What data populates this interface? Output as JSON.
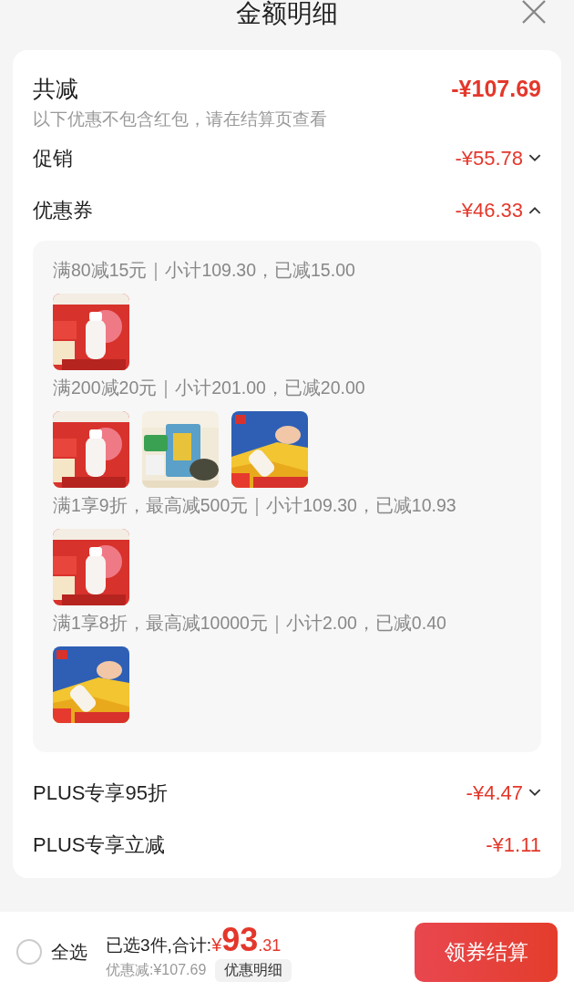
{
  "header": {
    "title": "金额明细"
  },
  "summary": {
    "label": "共减",
    "amount": "-¥107.69",
    "note": "以下优惠不包含红包，请在结算页查看"
  },
  "rows": [
    {
      "label": "促销",
      "amount": "-¥55.78",
      "expanded": false
    },
    {
      "label": "优惠券",
      "amount": "-¥46.33",
      "expanded": true,
      "groups": [
        {
          "title": "满80减15元｜小计109.30，已减15.00"
        },
        {
          "title": "满200减20元｜小计201.00，已减20.00"
        },
        {
          "title": "满1享9折，最高减500元｜小计109.30，已减10.93"
        },
        {
          "title": "满1享8折，最高减10000元｜小计2.00，已减0.40"
        }
      ]
    },
    {
      "label": "PLUS专享95折",
      "amount": "-¥4.47",
      "expanded": false
    },
    {
      "label": "PLUS专享立减",
      "amount": "-¥1.11"
    }
  ],
  "footer": {
    "select_all": {
      "label": "全选",
      "checked": false
    },
    "selected_text": "已选3件,合计:",
    "currency": "¥",
    "total_integer": "93",
    "total_decimal": ".31",
    "discount": "优惠减:¥107.69",
    "details_button": "优惠明细",
    "checkout_button": "领券结算"
  }
}
